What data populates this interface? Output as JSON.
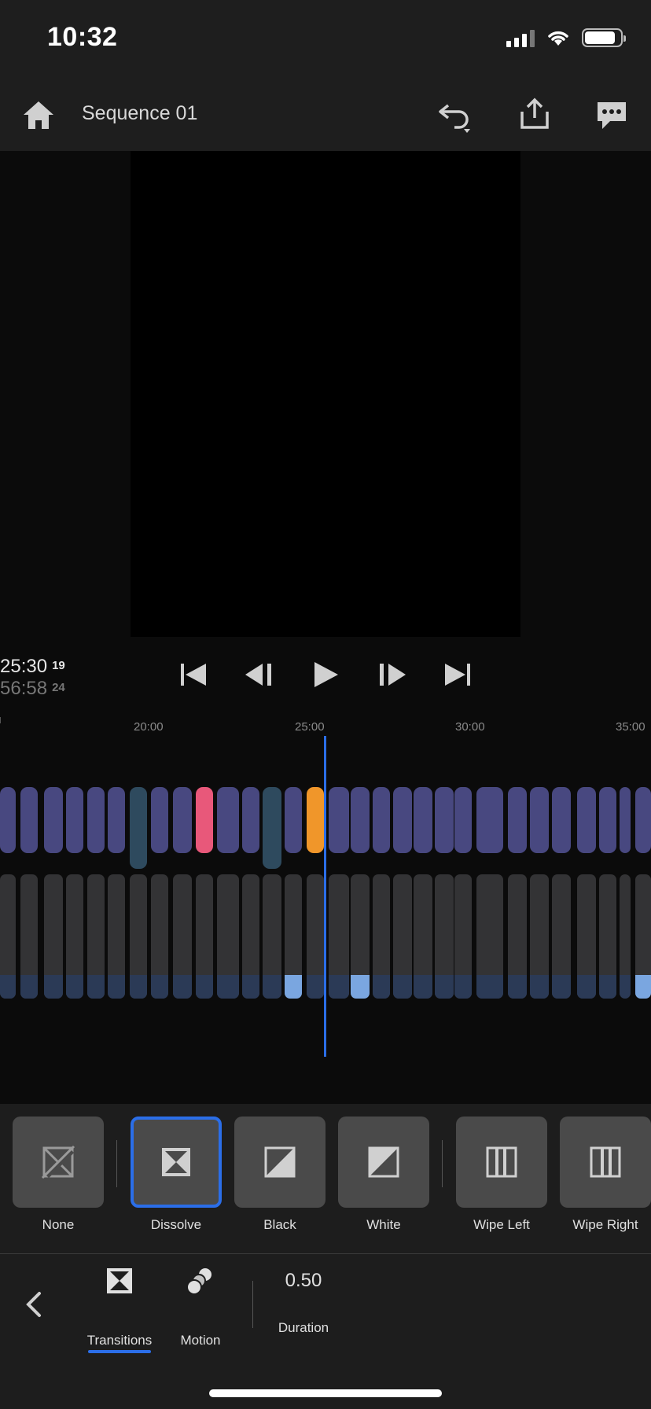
{
  "status_bar": {
    "time": "10:32",
    "battery_level": 0.8,
    "signal_bars": 4
  },
  "header": {
    "title": "Sequence 01"
  },
  "transport": {
    "current_time": "25:30",
    "current_frames": "19",
    "total_time": "56:58",
    "total_frames": "24"
  },
  "ruler": {
    "labels": [
      "20:00",
      "25:00",
      "30:00",
      "35:00"
    ]
  },
  "transitions": {
    "items": [
      {
        "label": "None",
        "icon": "no-transition-icon"
      },
      {
        "label": "Dissolve",
        "icon": "dissolve-icon",
        "selected": true
      },
      {
        "label": "Black",
        "icon": "fade-black-icon"
      },
      {
        "label": "White",
        "icon": "fade-white-icon"
      },
      {
        "label": "Wipe Left",
        "icon": "wipe-left-icon"
      },
      {
        "label": "Wipe Right",
        "icon": "wipe-right-icon"
      }
    ]
  },
  "bottom_bar": {
    "tabs": [
      {
        "label": "Transitions",
        "icon": "transitions-icon",
        "active": true
      },
      {
        "label": "Motion",
        "icon": "motion-icon"
      }
    ],
    "duration_value": "0.50",
    "duration_label": "Duration"
  },
  "colors": {
    "accent": "#2b6ee8",
    "video_clip": "#484880",
    "selected_clip": "#f0962a",
    "pink_clip": "#e8587a",
    "audio_clip": "#333335",
    "panel": "#1d1d1d"
  }
}
